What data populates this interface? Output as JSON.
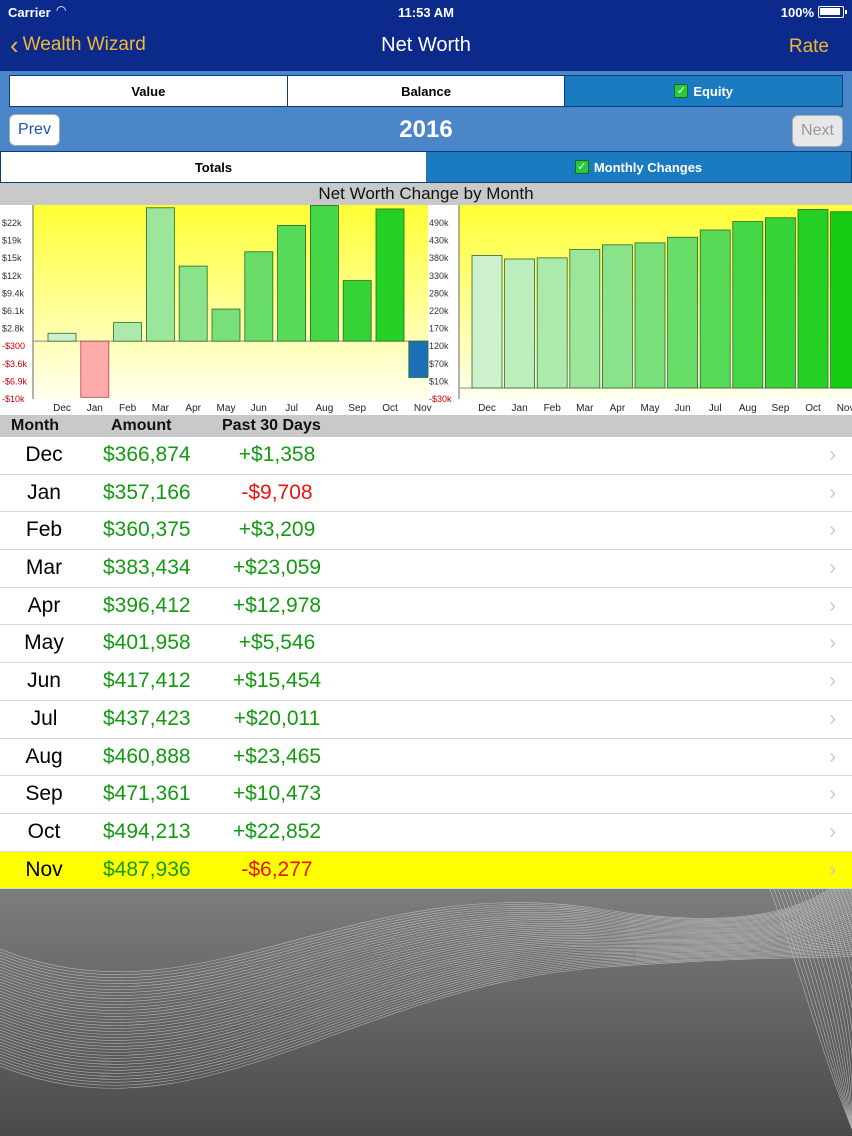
{
  "status": {
    "carrier": "Carrier",
    "time": "11:53 AM",
    "battery": "100%"
  },
  "nav": {
    "back_label": "Wealth Wizard",
    "title": "Net Worth",
    "rate_label": "Rate"
  },
  "view_tabs": [
    {
      "label": "Value"
    },
    {
      "label": "Balance"
    },
    {
      "label": "Equity",
      "selected": true
    }
  ],
  "year_nav": {
    "prev_label": "Prev",
    "year": "2016",
    "next_label": "Next"
  },
  "mode_tabs": [
    {
      "label": "Totals"
    },
    {
      "label": "Monthly Changes",
      "selected": true
    }
  ],
  "chart_title": "Net Worth Change by Month",
  "chart_data": [
    {
      "type": "bar",
      "categories": [
        "Dec",
        "Jan",
        "Feb",
        "Mar",
        "Apr",
        "May",
        "Jun",
        "Jul",
        "Aug",
        "Sep",
        "Oct",
        "Nov"
      ],
      "values": [
        1358,
        -9708,
        3209,
        23059,
        12978,
        5546,
        15454,
        20011,
        23465,
        10473,
        22852,
        -6277
      ],
      "left_ticks": [
        "$22k",
        "$19k",
        "$15k",
        "$12k",
        "$9.4k",
        "$6.1k",
        "$2.8k",
        "-$300",
        "-$3.6k",
        "-$6.9k",
        "-$10k"
      ],
      "right_ticks": [
        "490k",
        "430k",
        "380k",
        "330k",
        "280k",
        "220k",
        "170k",
        "120k",
        "$70k",
        "$10k",
        "-$30k"
      ],
      "ylim": [
        -10000,
        22500
      ]
    },
    {
      "type": "bar",
      "categories": [
        "Dec",
        "Jan",
        "Feb",
        "Mar",
        "Apr",
        "May",
        "Jun",
        "Jul",
        "Aug",
        "Sep",
        "Oct",
        "Nov"
      ],
      "values": [
        366874,
        357166,
        360375,
        383434,
        396412,
        401958,
        417412,
        437423,
        460888,
        471361,
        494213,
        487936
      ],
      "ylim": [
        -30000,
        490000
      ]
    }
  ],
  "table": {
    "headers": {
      "month": "Month",
      "amount": "Amount",
      "change": "Past 30 Days"
    },
    "rows": [
      {
        "month": "Dec",
        "amount": "$366,874",
        "change": "+$1,358",
        "neg": false
      },
      {
        "month": "Jan",
        "amount": "$357,166",
        "change": "-$9,708",
        "neg": true
      },
      {
        "month": "Feb",
        "amount": "$360,375",
        "change": "+$3,209",
        "neg": false
      },
      {
        "month": "Mar",
        "amount": "$383,434",
        "change": "+$23,059",
        "neg": false
      },
      {
        "month": "Apr",
        "amount": "$396,412",
        "change": "+$12,978",
        "neg": false
      },
      {
        "month": "May",
        "amount": "$401,958",
        "change": "+$5,546",
        "neg": false
      },
      {
        "month": "Jun",
        "amount": "$417,412",
        "change": "+$15,454",
        "neg": false
      },
      {
        "month": "Jul",
        "amount": "$437,423",
        "change": "+$20,011",
        "neg": false
      },
      {
        "month": "Aug",
        "amount": "$460,888",
        "change": "+$23,465",
        "neg": false
      },
      {
        "month": "Sep",
        "amount": "$471,361",
        "change": "+$10,473",
        "neg": false
      },
      {
        "month": "Oct",
        "amount": "$494,213",
        "change": "+$22,852",
        "neg": false
      },
      {
        "month": "Nov",
        "amount": "$487,936",
        "change": "-$6,277",
        "neg": true,
        "highlight": true
      }
    ]
  },
  "colors": {
    "nav_bg": "#0b2a8c",
    "accent": "#f2b632",
    "segment_active": "#1a7bc0",
    "positive": "#139a13",
    "negative": "#ee1111",
    "highlight": "#ffff00"
  }
}
